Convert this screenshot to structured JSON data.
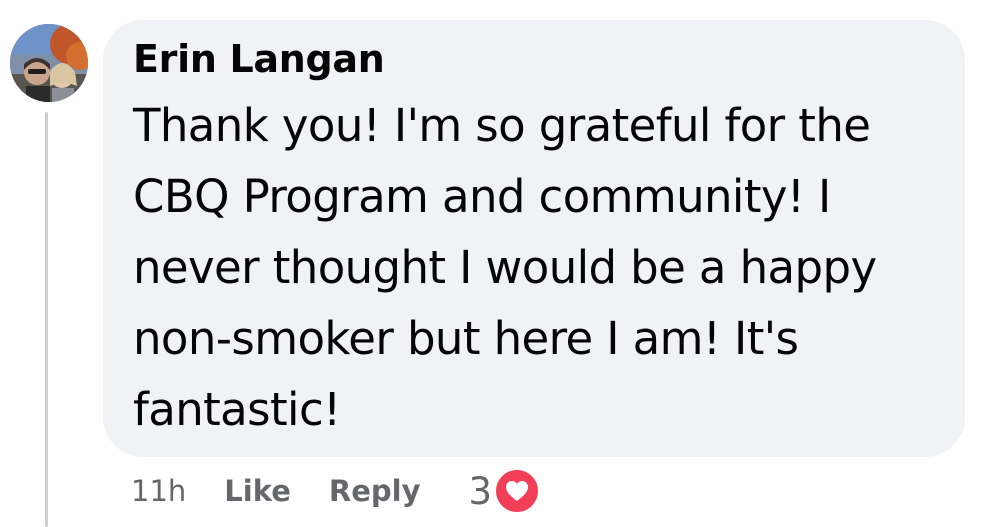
{
  "comment": {
    "author": "Erin Langan",
    "body": "Thank you! I'm so grateful for the CBQ Program and community! I never thought I would be a happy non-smoker but here I am! It's fantastic!",
    "timestamp": "11h",
    "like_label": "Like",
    "reply_label": "Reply",
    "reaction_count": "3",
    "reaction_icon": "heart-icon",
    "reaction_color": "#f33e58"
  },
  "colors": {
    "bubble_bg": "#f0f2f5",
    "text": "#050505",
    "secondary_text": "#65676b",
    "thread_line": "#ced0d4"
  }
}
